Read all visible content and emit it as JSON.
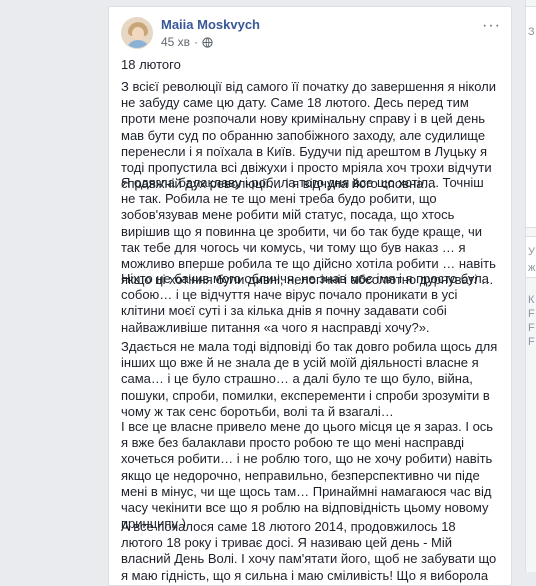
{
  "post": {
    "author": "Maiia Moskvych",
    "time": "45 хв",
    "privacy_icon": "globe-icon",
    "more_icon": "more-options-icon",
    "more_label": "···",
    "paragraphs": [
      "18 лютого",
      "З всієї революції від самого її початку до завершення я ніколи не забуду саме цю дату. Саме 18 лютого. Десь перед тим проти мене розпочали нову кримінальну справу і в цей день мав бути суд по обранню запобіжного заходу, але судилище перенесли і я поїхала в Київ. Будучи під арештом в Луцьку я тоді пропустила всі двіжухи і просто мріяла хоч трохи відчути справжній дух революції… і я відчула його сповна…",
      "Я одягла балаклаву і робила того дня все що хотіла. Точніш не так. Робила не те що мені треба будо робити, що зобов'язував мене робити мій статус, посада, що хтось вирішив що я повинна це зробити, чи бо так буде краще, чи так тебе для чогось чи комусь, чи тому що був наказ … я можливо вперше робила те що дійсно хотіла робити … навіть якщо ці хотіння були дивні, нелогічні і абсолютно дурнуваті …",
      "Ніхто не бачив мого обличчя, не знав моє імя і я просто була собою… і це відчуття наче вірус почало проникати в усі клітини моєї суті і за кілька днів я почну задавати собі найважливіше питання «а чого я насправді хочу?».",
      "Здається не мала тоді відповіді бо так довго робила щось для інших що вже й не знала де в усій моїй діяльності власне я сама… і це було страшно… а далі було те що було, війна, пошуки, спроби, помилки, експеременти і спроби зрозуміти в чому ж так сенс боротьби, волі та й взагалі…",
      "І все це власне привело мене до цього місця це я зараз. І ось я вже без балаклави просто робою те що мені насправді хочеться робити… і не роблю того, що не хочу робити) навіть якщо це недорочно, неправильно, безперспективно чи піде мені в мінус, чи ще щось там… Принаймні намагаюся час від часу чекінити все що я роблю на відповідність цьому новому принципу )",
      "А все почалося саме 18 лютого 2014, продовжилось 18 лютого 18 року і триває досі. Я називаю цей день - Мій власний День Волі. І хочу пам'ятати його, щоб не забувати що я маю гідність, що я сильна і маю сміливість! Що я виборола свою волю в боротьбі і не зміщу її нікому"
    ]
  },
  "sidebar_right": {
    "chars": [
      "З",
      "У",
      "ж",
      "К",
      "F",
      "F",
      "F"
    ]
  }
}
